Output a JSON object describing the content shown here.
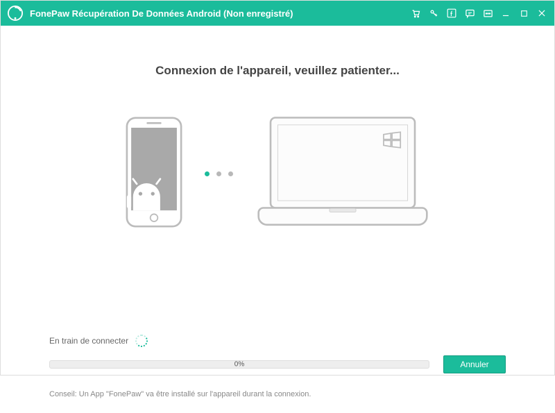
{
  "titlebar": {
    "title": "FonePaw Récupération De Données Android (Non enregistré)"
  },
  "main": {
    "heading": "Connexion de l'appareil, veuillez patienter...",
    "status_label": "En train de connecter",
    "progress_text": "0%",
    "cancel_label": "Annuler",
    "tip": "Conseil: Un App \"FonePaw\" va être installé sur l'appareil durant la connexion."
  },
  "colors": {
    "accent": "#1bbc9b"
  }
}
